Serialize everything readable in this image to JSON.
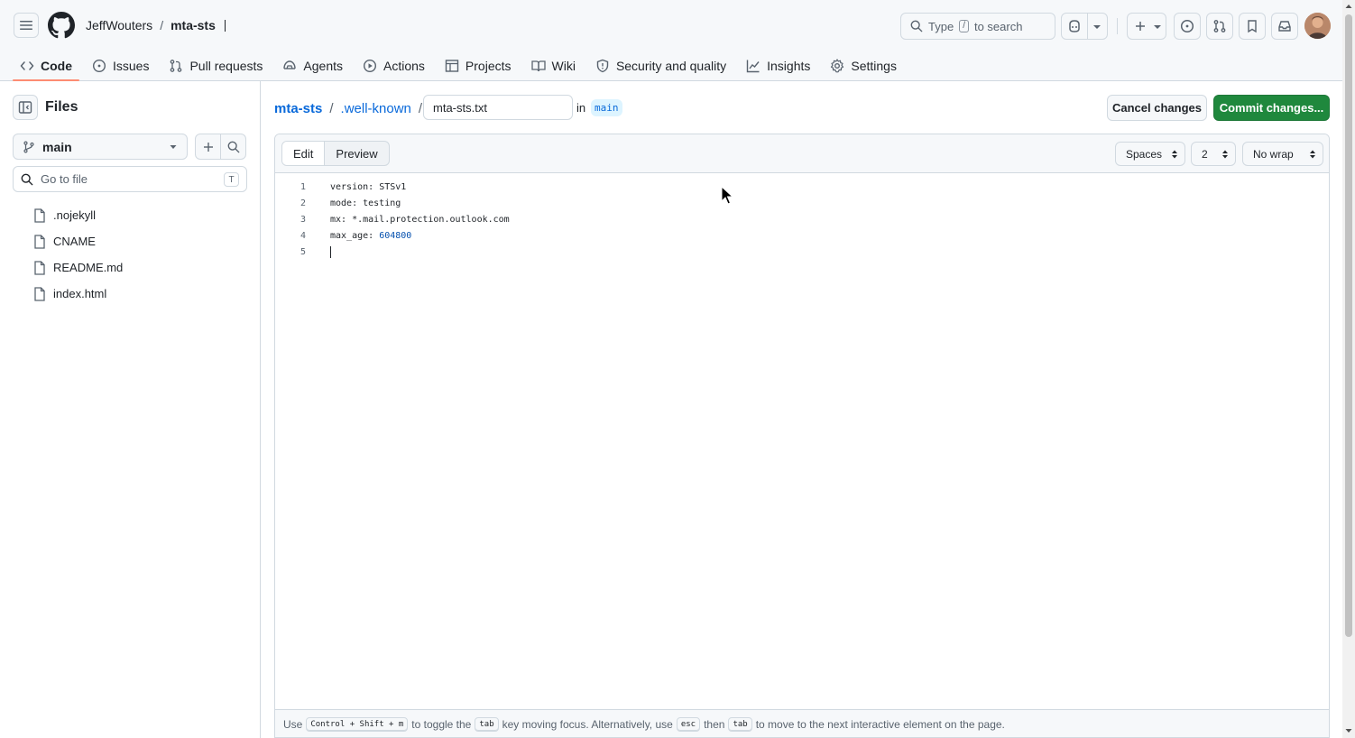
{
  "header": {
    "owner": "JeffWouters",
    "repo": "mta-sts",
    "search": {
      "prefix": "Type",
      "key": "/",
      "suffix": "to search"
    }
  },
  "nav": {
    "tabs": [
      {
        "label": "Code",
        "icon": "code-icon",
        "active": true
      },
      {
        "label": "Issues",
        "icon": "issue-opened-icon"
      },
      {
        "label": "Pull requests",
        "icon": "git-pull-request-icon"
      },
      {
        "label": "Agents",
        "icon": "agent-icon"
      },
      {
        "label": "Actions",
        "icon": "play-icon"
      },
      {
        "label": "Projects",
        "icon": "table-icon"
      },
      {
        "label": "Wiki",
        "icon": "book-icon"
      },
      {
        "label": "Security and quality",
        "icon": "shield-icon"
      },
      {
        "label": "Insights",
        "icon": "graph-icon"
      },
      {
        "label": "Settings",
        "icon": "gear-icon"
      }
    ]
  },
  "sidebar": {
    "title": "Files",
    "branch": "main",
    "goto_placeholder": "Go to file",
    "goto_key": "T",
    "files": [
      ".nojekyll",
      "CNAME",
      "README.md",
      "index.html"
    ]
  },
  "main": {
    "breadcrumb": {
      "repo": "mta-sts",
      "folder": ".well-known"
    },
    "filename": "mta-sts.txt",
    "in_label": "in",
    "branch": "main",
    "cancel_label": "Cancel changes",
    "commit_label": "Commit changes..."
  },
  "editor": {
    "tabs": {
      "edit": "Edit",
      "preview": "Preview"
    },
    "indent_mode": "Spaces",
    "indent_size": "2",
    "wrap_mode": "No wrap",
    "lines": [
      {
        "n": "1",
        "key": "version: ",
        "value": "STSv1"
      },
      {
        "n": "2",
        "key": "mode: ",
        "value": "testing"
      },
      {
        "n": "3",
        "key": "mx: ",
        "value": "*.mail.protection.outlook.com"
      },
      {
        "n": "4",
        "key": "max_age: ",
        "value": "604800"
      },
      {
        "n": "5",
        "key": "",
        "value": ""
      }
    ],
    "footer": {
      "use": "Use",
      "shortcut": "Control + Shift + m",
      "text1": "to toggle the",
      "tab": "tab",
      "text2": "key moving focus. Alternatively, use",
      "esc": "esc",
      "then": "then",
      "text3": "to move to the next interactive element on the page."
    }
  },
  "colors": {
    "accent_link": "#0969da",
    "commit_green": "#1f883d",
    "active_tab_underline": "#fd8c73"
  }
}
